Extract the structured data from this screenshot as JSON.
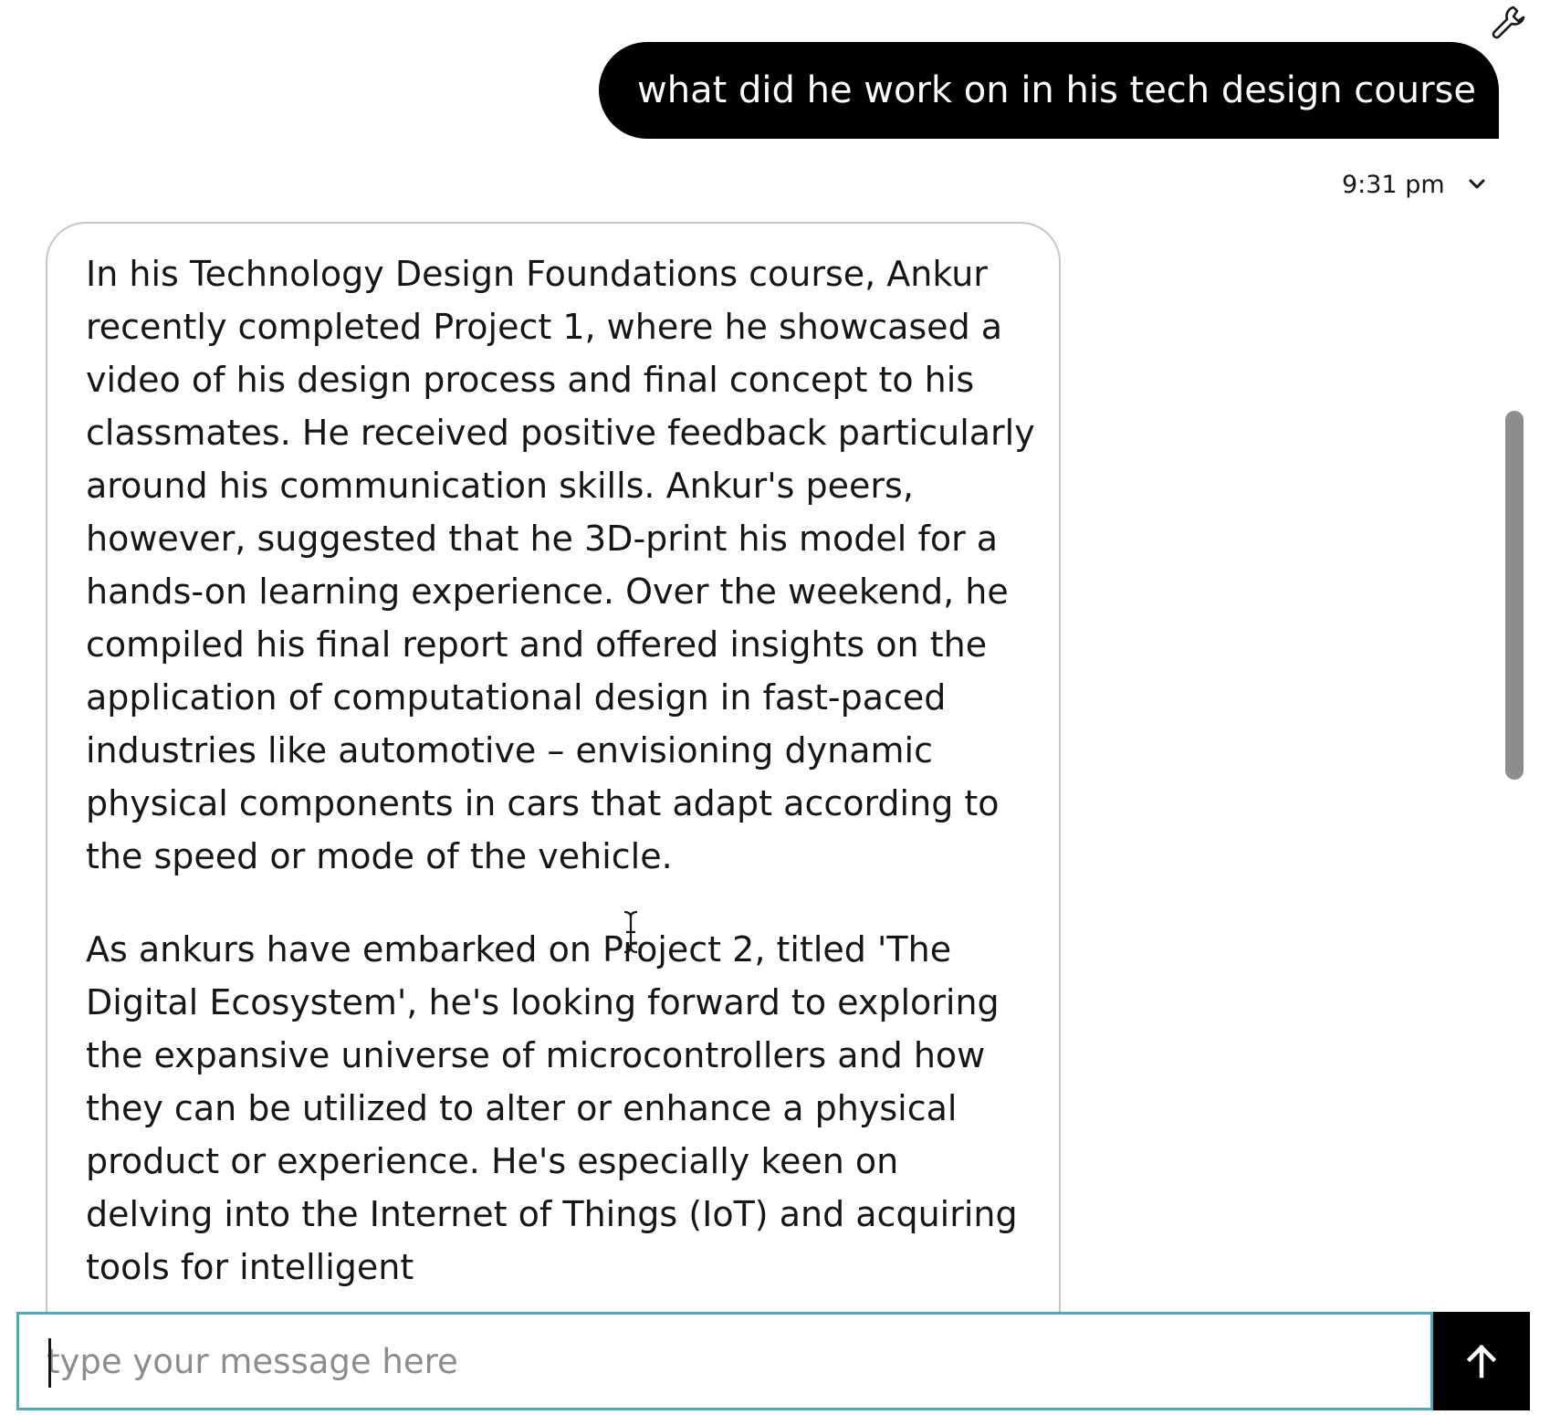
{
  "toolbar": {
    "settings_icon": "wrench-icon"
  },
  "user_message": {
    "text": "what did he work on in his tech design course",
    "timestamp": "9:31 pm",
    "expand_icon": "chevron-down-icon"
  },
  "assistant_message": {
    "paragraphs": [
      "In his Technology Design Foundations course, Ankur recently completed Project 1, where he showcased a video of his design process and final concept to his classmates. He received positive feedback particularly around his communication skills. Ankur's peers, however, suggested that he 3D-print his model for a hands-on learning experience. Over the weekend, he compiled his final report and offered insights on the application of computational design in fast-paced industries like automotive – envisioning dynamic physical components in cars that adapt according to the speed or mode of the vehicle.",
      "As ankurs have embarked on Project 2, titled 'The Digital Ecosystem', he's looking forward to exploring the expansive universe of microcontrollers and how they can be utilized to alter or enhance a physical product or experience. He's especially keen on delving into the Internet of Things (IoT) and acquiring tools for intelligent"
    ]
  },
  "composer": {
    "placeholder": "type your message here",
    "value": "",
    "send_icon": "arrow-up-icon"
  },
  "colors": {
    "user_bubble_bg": "#000000",
    "input_border": "#4fa9bf",
    "send_button_bg": "#000000",
    "scrollbar": "#8d8d8d"
  }
}
